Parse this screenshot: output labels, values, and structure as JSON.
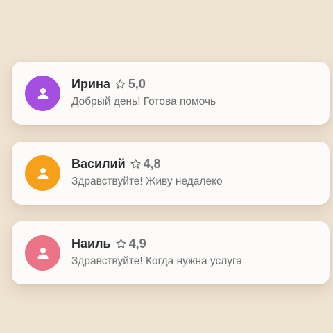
{
  "offers": [
    {
      "name": "Ирина",
      "rating": "5,0",
      "message": "Добрый день! Готова помочь",
      "avatar_color": "#a54fe0",
      "icon": "user-icon"
    },
    {
      "name": "Василий",
      "rating": "4,8",
      "message": "Здравствуйте! Живу недалеко",
      "avatar_color": "#f6a01c",
      "icon": "user-icon"
    },
    {
      "name": "Наиль",
      "rating": "4,9",
      "message": "Здравствуйте! Когда нужна услуга",
      "avatar_color": "#ea7485",
      "icon": "user-icon"
    }
  ],
  "colors": {
    "background": "#efe3d2",
    "card": "#fcfbfa",
    "name_text": "#2c2c2c",
    "secondary_text": "#6f6f6f"
  }
}
